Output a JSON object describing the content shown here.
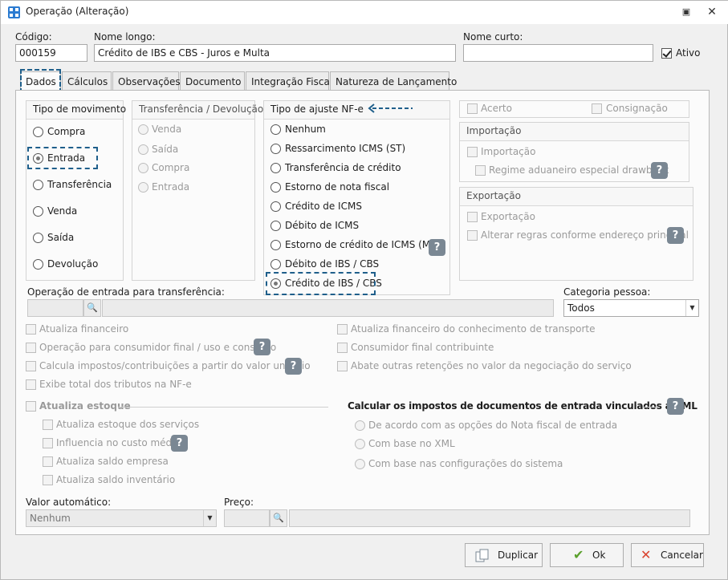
{
  "window": {
    "title": "Operação (Alteração)"
  },
  "header": {
    "codigo_label": "Código:",
    "codigo_value": "000159",
    "nome_longo_label": "Nome longo:",
    "nome_longo_value": "Crédito de IBS e CBS - Juros e Multa",
    "nome_curto_label": "Nome curto:",
    "nome_curto_value": "",
    "ativo_label": "Ativo",
    "ativo_checked": true
  },
  "tabs": [
    {
      "label": "Dados",
      "active": true
    },
    {
      "label": "Cálculos"
    },
    {
      "label": "Observações"
    },
    {
      "label": "Documento"
    },
    {
      "label": "Integração Fiscal"
    },
    {
      "label": "Natureza de Lançamento"
    }
  ],
  "tipo_movimento": {
    "title": "Tipo de movimento",
    "options": [
      "Compra",
      "Entrada",
      "Transferência",
      "Venda",
      "Saída",
      "Devolução"
    ],
    "selected": "Entrada"
  },
  "transferencia_devolucao": {
    "title": "Transferência / Devolução",
    "options": [
      "Venda",
      "Saída",
      "Compra",
      "Entrada"
    ]
  },
  "tipo_ajuste": {
    "title": "Tipo de ajuste NF-e",
    "options": [
      "Nenhum",
      "Ressarcimento ICMS (ST)",
      "Transferência de crédito",
      "Estorno de nota fiscal",
      "Crédito de ICMS",
      "Débito de ICMS",
      "Estorno de crédito de ICMS (MG)",
      "Débito de IBS / CBS",
      "Crédito de IBS / CBS"
    ],
    "selected": "Crédito de IBS / CBS"
  },
  "right_top": {
    "acerto": "Acerto",
    "consignacao": "Consignação"
  },
  "importacao": {
    "title": "Importação",
    "importacao": "Importação",
    "drawback": "Regime aduaneiro especial drawback"
  },
  "exportacao": {
    "title": "Exportação",
    "exportacao": "Exportação",
    "alterar": "Alterar regras conforme endereço principal"
  },
  "op_entrada": {
    "label": "Operação de entrada para transferência:",
    "code": "",
    "desc": ""
  },
  "categoria": {
    "label": "Categoria pessoa:",
    "value": "Todos"
  },
  "checks_left": [
    "Atualiza financeiro",
    "Operação para consumidor final / uso e consumo",
    "Calcula impostos/contribuições a partir do valor unitário",
    "Exibe total dos tributos na NF-e"
  ],
  "checks_right": [
    "Atualiza financeiro do conhecimento de transporte",
    "Consumidor final contribuinte",
    "Abate outras retenções no valor da negociação do serviço"
  ],
  "estoque": {
    "title": "Atualiza estoque",
    "items": [
      "Atualiza estoque dos serviços",
      "Influencia no custo médio",
      "Atualiza saldo empresa",
      "Atualiza saldo inventário"
    ]
  },
  "xml": {
    "title": "Calcular os impostos de documentos de entrada vinculados a XML",
    "options": [
      "De acordo com as opções do Nota fiscal de entrada",
      "Com base no XML",
      "Com base nas configurações do sistema"
    ]
  },
  "valor_auto": {
    "label": "Valor automático:",
    "value": "Nenhum"
  },
  "preco": {
    "label": "Preço:",
    "code": "",
    "desc": ""
  },
  "buttons": {
    "duplicar": "Duplicar",
    "ok": "Ok",
    "cancelar": "Cancelar"
  },
  "help_glyph": "?"
}
